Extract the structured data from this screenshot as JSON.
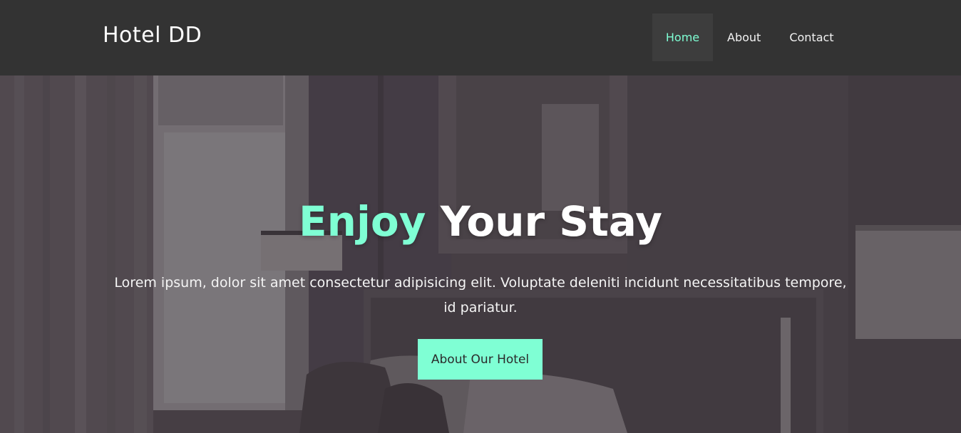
{
  "brand": "Hotel DD",
  "nav": {
    "items": [
      {
        "label": "Home",
        "active": true
      },
      {
        "label": "About",
        "active": false
      },
      {
        "label": "Contact",
        "active": false
      }
    ]
  },
  "hero": {
    "headline_accent": "Enjoy",
    "headline_rest": "Your Stay",
    "lead": "Lorem ipsum, dolor sit amet consectetur adipisicing elit. Voluptate deleniti incidunt necessitatibus tempore, id pariatur.",
    "cta_label": "About Our Hotel"
  },
  "colors": {
    "accent": "#7fffd4",
    "navbar": "#333333",
    "nav_active_bg": "#3d3d3d",
    "hero_overlay": "#4a4248"
  }
}
